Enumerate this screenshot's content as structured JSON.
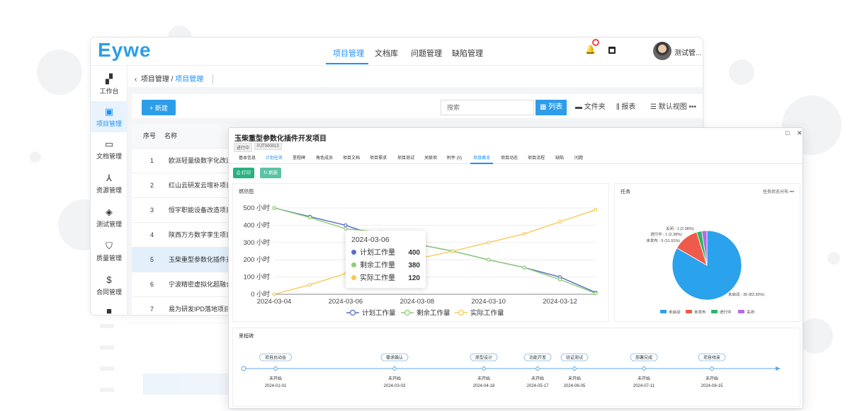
{
  "app": {
    "logo": "Eywe"
  },
  "nav": {
    "items": [
      "项目管理",
      "文档库",
      "问题管理",
      "缺陷管理"
    ],
    "user": "测试管..."
  },
  "sidebar": {
    "items": [
      "工作台",
      "项目管理",
      "文档管理",
      "资源管理",
      "测试管理",
      "质量管理",
      "合同管理"
    ]
  },
  "breadcrumb": {
    "parent": "项目管理",
    "current": "项目管理"
  },
  "toolbar": {
    "new_label": "新建",
    "search_placeholder": "搜索",
    "views": [
      "列表",
      "文件夹",
      "报表",
      "默认视图"
    ]
  },
  "table": {
    "headers": [
      "序号",
      "名称"
    ],
    "rows": [
      {
        "no": "1",
        "name": "欧派轻量级数字化改造"
      },
      {
        "no": "2",
        "name": "红山云研发云增补项目"
      },
      {
        "no": "3",
        "name": "恒宇职能设备改造项目"
      },
      {
        "no": "4",
        "name": "陕西万方数字孪生项目"
      },
      {
        "no": "5",
        "name": "玉柴重型参数化插件开"
      },
      {
        "no": "6",
        "name": "宁波精密虚拟化超融合"
      },
      {
        "no": "7",
        "name": "易为研发IPD落地项目"
      }
    ]
  },
  "detail": {
    "title": "玉柴重型参数化插件开发项目",
    "status": "进行中",
    "code": "PJT000013",
    "tabs": [
      "基本信息",
      "计划任务",
      "里程碑",
      "角色成员",
      "项目文档",
      "项目需求",
      "项目测试",
      "关联项",
      "附件 (0)",
      "项目概览",
      "项目动态",
      "项目流程",
      "缺陷",
      "问题"
    ],
    "print_label": "打印",
    "refresh_label": "刷新",
    "burndown_title": "燃尽图",
    "tasks_title": "任务",
    "tasks_dist": "任务状态分布",
    "milestone_title": "里程碑"
  },
  "tooltip": {
    "date": "2024-03-06",
    "rows": [
      {
        "name": "计划工作量",
        "value": "400",
        "color": "#5470c6"
      },
      {
        "name": "剩余工作量",
        "value": "380",
        "color": "#91cc75"
      },
      {
        "name": "实际工作量",
        "value": "120",
        "color": "#fac858"
      }
    ]
  },
  "chart_data": [
    {
      "type": "line",
      "title": "燃尽图",
      "x": [
        "2024-03-04",
        "2024-03-05",
        "2024-03-06",
        "2024-03-07",
        "2024-03-08",
        "2024-03-09",
        "2024-03-10",
        "2024-03-11",
        "2024-03-12",
        "2024-03-13"
      ],
      "x_ticks": [
        "2024-03-04",
        "2024-03-06",
        "2024-03-08",
        "2024-03-10",
        "2024-03-12"
      ],
      "y_ticks": [
        "0 小时",
        "100 小时",
        "200 小时",
        "300 小时",
        "400 小时",
        "500 小时"
      ],
      "ylim": [
        0,
        500
      ],
      "series": [
        {
          "name": "计划工作量",
          "color": "#5470c6",
          "values": [
            500,
            450,
            400,
            330,
            290,
            250,
            200,
            155,
            100,
            10
          ]
        },
        {
          "name": "剩余工作量",
          "color": "#91cc75",
          "values": [
            500,
            445,
            380,
            360,
            290,
            250,
            200,
            155,
            85,
            5
          ]
        },
        {
          "name": "实际工作量",
          "color": "#fac858",
          "values": [
            0,
            55,
            120,
            170,
            205,
            250,
            300,
            350,
            420,
            490
          ]
        }
      ]
    },
    {
      "type": "pie",
      "title": "任务",
      "slices": [
        {
          "name": "未启动",
          "value": 35,
          "label": "未启动 : 35 (83.33%)",
          "color": "#2ba2ec"
        },
        {
          "name": "未发布",
          "value": 5,
          "label": "未发布 : 5 (11.91%)",
          "color": "#ee5b4a"
        },
        {
          "name": "进行中",
          "value": 1,
          "label": "进行中 : 1 (2.38%)",
          "color": "#2bb564"
        },
        {
          "name": "关闭",
          "value": 1,
          "label": "关闭 : 1 (2.38%)",
          "color": "#b569e6"
        }
      ]
    }
  ],
  "milestones": [
    {
      "name": "项目启动会",
      "status": "未开始",
      "date": "2024-01-01"
    },
    {
      "name": "需求确认",
      "status": "未开始",
      "date": "2024-03-03"
    },
    {
      "name": "原型设计",
      "status": "未开始",
      "date": "2024-04-18"
    },
    {
      "name": "功能开发",
      "status": "未开始",
      "date": "2024-05-17"
    },
    {
      "name": "验证测试",
      "status": "未开始",
      "date": "2024-06-05"
    },
    {
      "name": "部署完成",
      "status": "未开始",
      "date": "2024-07-11"
    },
    {
      "name": "项目结束",
      "status": "未开始",
      "date": "2024-08-15"
    }
  ]
}
